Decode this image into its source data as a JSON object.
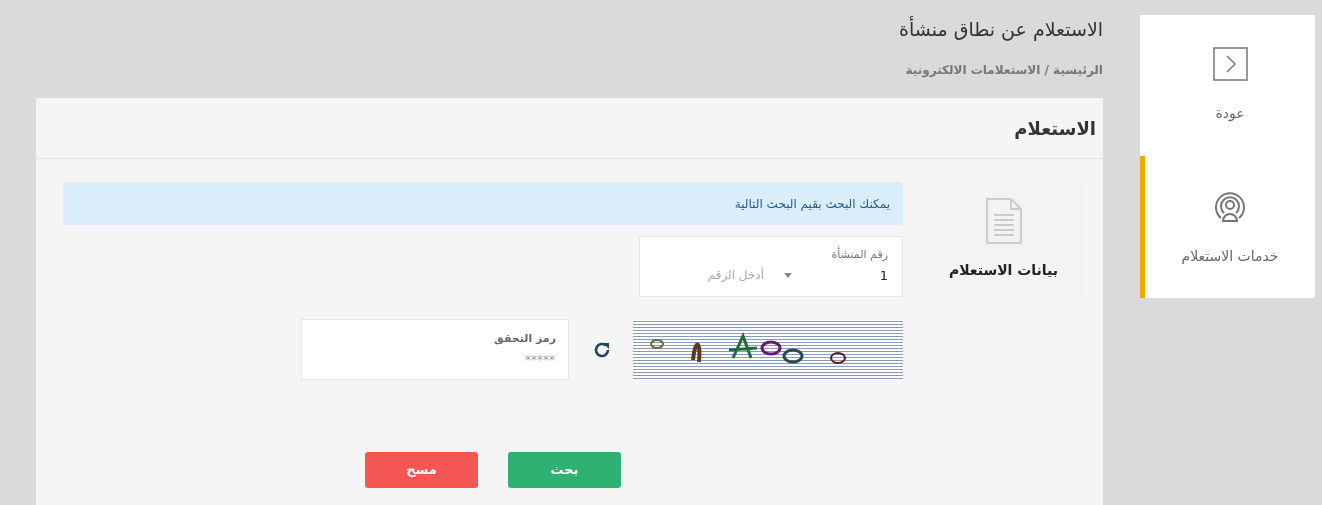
{
  "sidebar": {
    "items": [
      {
        "kind": "back",
        "label": "عودة",
        "selected": false
      },
      {
        "kind": "services",
        "label": "خدمات الاستعلام",
        "selected": true
      }
    ]
  },
  "page": {
    "title": "الاستعلام عن نطاق منشأة",
    "breadcrumb": "الرئيسية / الاستعلامات الالكترونية"
  },
  "card": {
    "title": "الاستعلام",
    "section_tab": "بيانات الاستعلام",
    "alert": "يمكنك البحث بقيم البحث التالية",
    "establishment_field": {
      "label": "رقم المنشأة",
      "value": "1",
      "placeholder": "أدخل الرقم"
    },
    "captcha_field": {
      "label": "رمز التحقق",
      "placeholder": "*****"
    },
    "buttons": [
      {
        "kind": "primary",
        "label": "بحث"
      },
      {
        "kind": "danger",
        "label": "مسح"
      }
    ]
  }
}
